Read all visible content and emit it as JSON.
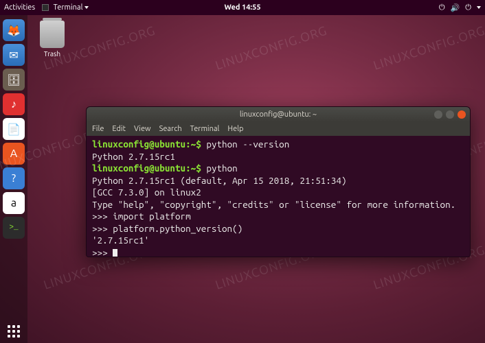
{
  "topbar": {
    "activities": "Activities",
    "app": "Terminal",
    "clock": "Wed 14:55"
  },
  "desktop": {
    "trash_label": "Trash"
  },
  "watermark": "LINUXCONFIG.ORG",
  "terminal": {
    "title": "linuxconfig@ubuntu: ~",
    "menu": [
      "File",
      "Edit",
      "View",
      "Search",
      "Terminal",
      "Help"
    ],
    "lines": [
      {
        "prompt": "linuxconfig@ubuntu:~$ ",
        "cmd": "python --version"
      },
      {
        "text": "Python 2.7.15rc1"
      },
      {
        "prompt": "linuxconfig@ubuntu:~$ ",
        "cmd": "python"
      },
      {
        "text": "Python 2.7.15rc1 (default, Apr 15 2018, 21:51:34)"
      },
      {
        "text": "[GCC 7.3.0] on linux2"
      },
      {
        "text": "Type \"help\", \"copyright\", \"credits\" or \"license\" for more information."
      },
      {
        "text": ">>> import platform"
      },
      {
        "text": ">>> platform.python_version()"
      },
      {
        "text": "'2.7.15rc1'"
      },
      {
        "text": ">>> ",
        "cursor": true
      }
    ]
  },
  "dock": {
    "items": [
      {
        "name": "firefox-icon",
        "glyph": "🦊"
      },
      {
        "name": "thunderbird-icon",
        "glyph": "✉"
      },
      {
        "name": "files-icon",
        "glyph": "🗄"
      },
      {
        "name": "rhythmbox-icon",
        "glyph": "♪"
      },
      {
        "name": "writer-icon",
        "glyph": "📄"
      },
      {
        "name": "software-icon",
        "glyph": "A"
      },
      {
        "name": "help-icon",
        "glyph": "?"
      },
      {
        "name": "amazon-icon",
        "glyph": "a"
      },
      {
        "name": "terminal-icon",
        "glyph": ">_"
      }
    ]
  }
}
